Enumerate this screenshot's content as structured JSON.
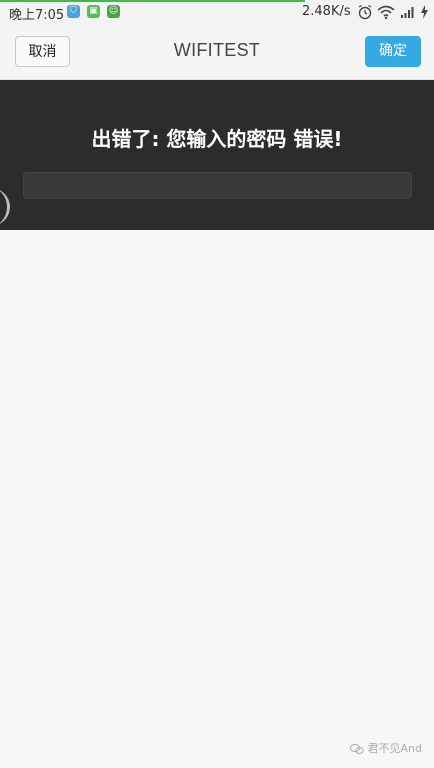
{
  "status_bar": {
    "time": "晚上7:05",
    "badges": [
      {
        "name": "shield-badge-icon",
        "color": "#4aa3df",
        "glyph": "☗"
      },
      {
        "name": "app-badge-icon",
        "color": "#5cb85c",
        "glyph": "▣"
      },
      {
        "name": "smiley-badge-icon",
        "color": "#45a847",
        "glyph": "☺"
      }
    ],
    "speed": "2.48K/s",
    "icons": [
      "alarm-icon",
      "wifi-icon",
      "signal-icon",
      "battery-charging-icon"
    ]
  },
  "header": {
    "cancel_label": "取消",
    "title": "WIFITEST",
    "ok_label": "确定",
    "ok_color": "#36a9e1"
  },
  "panel": {
    "error_message": "出错了: 您输入的密码 错误!",
    "background": "#2c2b2d"
  },
  "watermark": {
    "text": "君不见And"
  }
}
